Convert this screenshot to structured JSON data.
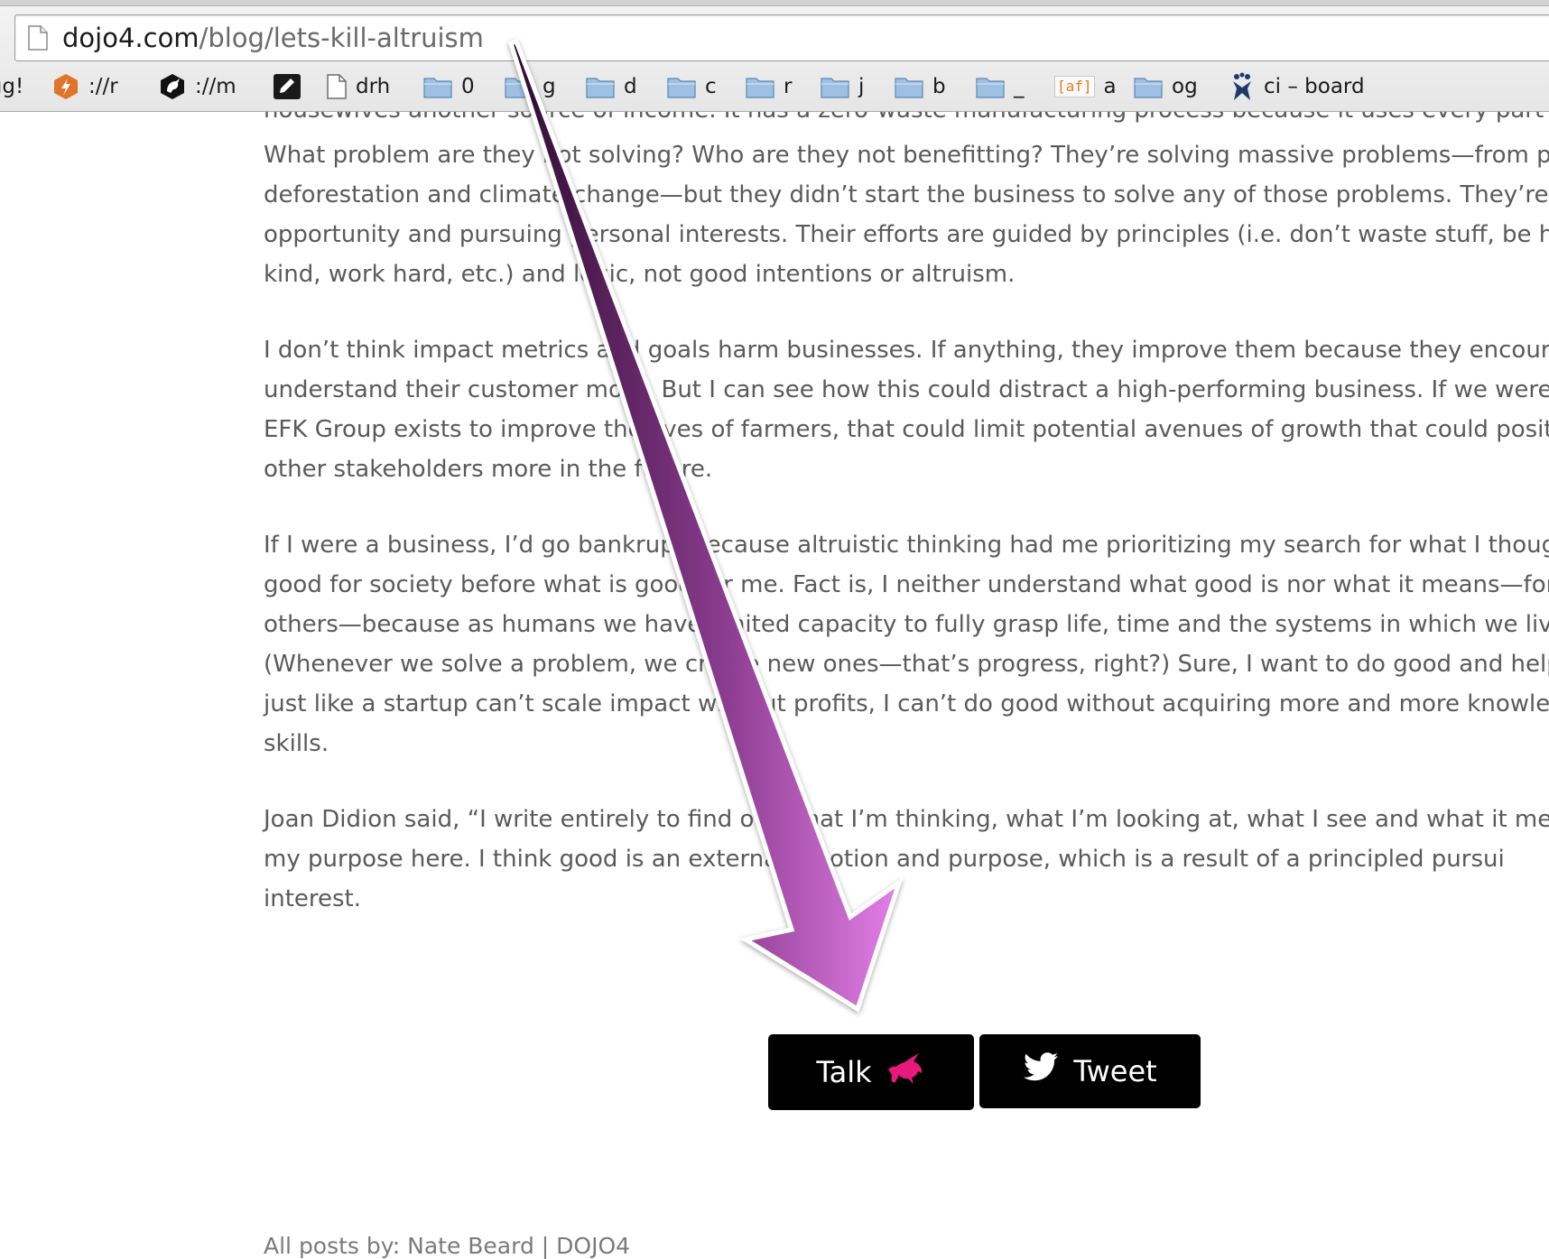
{
  "browser": {
    "url_host": "dojo4.com",
    "url_path": "/blog/lets-kill-altruism",
    "bookmarks": [
      {
        "label": "ıg!",
        "icon": "none"
      },
      {
        "label": "://r",
        "icon": "orange-lightning-icon"
      },
      {
        "label": "://m",
        "icon": "unicorn-badge-icon"
      },
      {
        "label": "",
        "icon": "pencil-icon"
      },
      {
        "label": "drh",
        "icon": "page-icon"
      },
      {
        "label": "0",
        "icon": "folder-icon"
      },
      {
        "label": "g",
        "icon": "folder-icon"
      },
      {
        "label": "d",
        "icon": "folder-icon"
      },
      {
        "label": "c",
        "icon": "folder-icon"
      },
      {
        "label": "r",
        "icon": "folder-icon"
      },
      {
        "label": "j",
        "icon": "folder-icon"
      },
      {
        "label": "b",
        "icon": "folder-icon"
      },
      {
        "label": "_",
        "icon": "folder-icon"
      },
      {
        "label": "a",
        "icon": "af-badge-icon",
        "badge_text": "[af]"
      },
      {
        "label": "og",
        "icon": "folder-icon"
      },
      {
        "label": "ci – board",
        "icon": "jenkins-icon"
      }
    ]
  },
  "article": {
    "clipped_top_line": "housewives another source of income. It has a zero-waste manufacturing process because it uses every part of",
    "paragraphs": [
      [
        "What problem are they not solving? Who are they not benefitting? They’re solving massive problems—from po",
        "deforestation and climate change—but they didn’t start the business to solve any of those problems. They’re e",
        "opportunity and pursuing personal interests. Their efforts are guided by principles (i.e. don’t waste stuff, be ho",
        "kind, work hard, etc.) and logic, not good intentions or altruism."
      ],
      [
        "I don’t think impact metrics and goals harm businesses. If anything, they improve them because they encoura",
        "understand their customer more. But I can see how this could distract a high-performing business. If we were",
        "EFK Group exists to improve the lives of farmers, that could limit potential avenues of growth that could posit",
        "other stakeholders more in the future."
      ],
      [
        "If I were a business, I’d go bankrupt because altruistic thinking had me prioritizing my search for what I thoug",
        "good for society before what is good for me. Fact is, I neither understand what good is nor what it means—for",
        "others—because as humans we have limited capacity to fully grasp life, time and the systems in which we liv",
        "(Whenever we solve a problem, we create new ones—that’s progress, right?) Sure, I want to do good and help",
        "just like a startup can’t scale impact without profits, I can’t do good without acquiring more and more knowled",
        "skills."
      ],
      [
        "Joan Didion said, “I write entirely to find out what I’m thinking, what I’m looking at, what I see and what it mea",
        "my purpose here. I think good is an external emotion and purpose, which is a result of a principled pursui",
        "interest."
      ]
    ]
  },
  "share": {
    "talk_label": "Talk",
    "tweet_label": "Tweet",
    "unicorn_color": "#e8197d",
    "button_bg": "#000000"
  },
  "footer": {
    "text": "All posts by: Nate Beard  |  DOJO4"
  },
  "annotation": {
    "type": "arrow",
    "points_to": "Talk button",
    "color_dark": "#2c0b2e",
    "color_light": "#e47fe8"
  }
}
